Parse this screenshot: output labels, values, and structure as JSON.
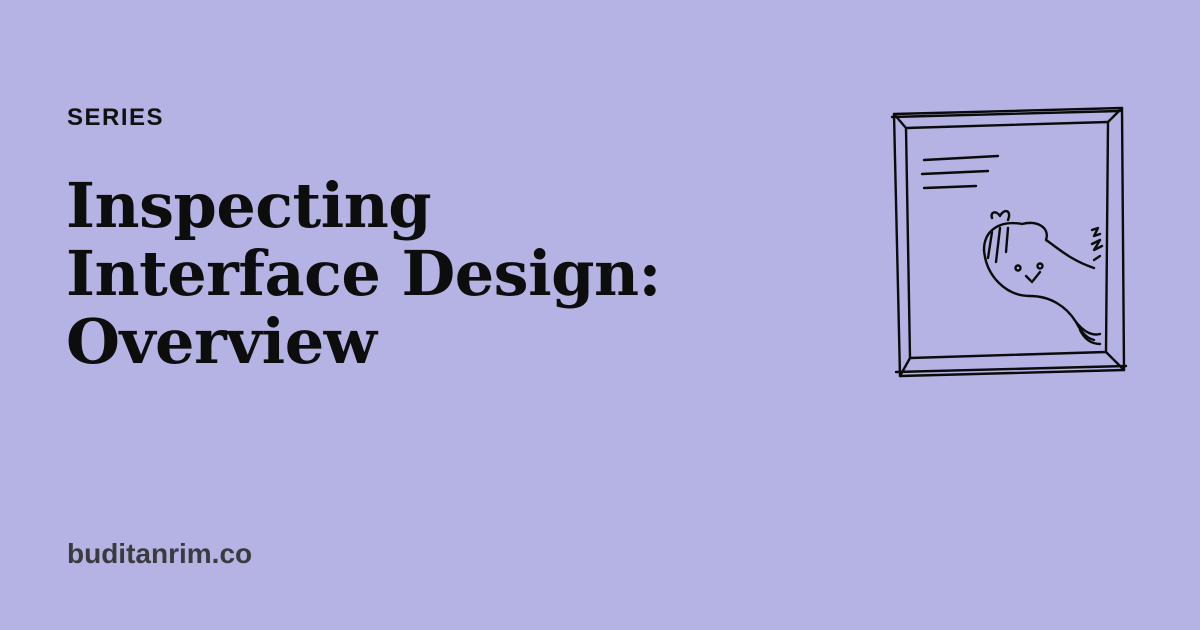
{
  "card": {
    "eyebrow": "SERIES",
    "title_lines": [
      "Inspecting",
      "Interface Design:",
      "Overview"
    ],
    "site": "buditanrim.co"
  },
  "colors": {
    "background": "#b5b3e3",
    "text": "#0d0d0d",
    "muted_text": "#3b3b3f"
  },
  "illustration": {
    "icon": "sketch-window-peeking-face-icon"
  }
}
